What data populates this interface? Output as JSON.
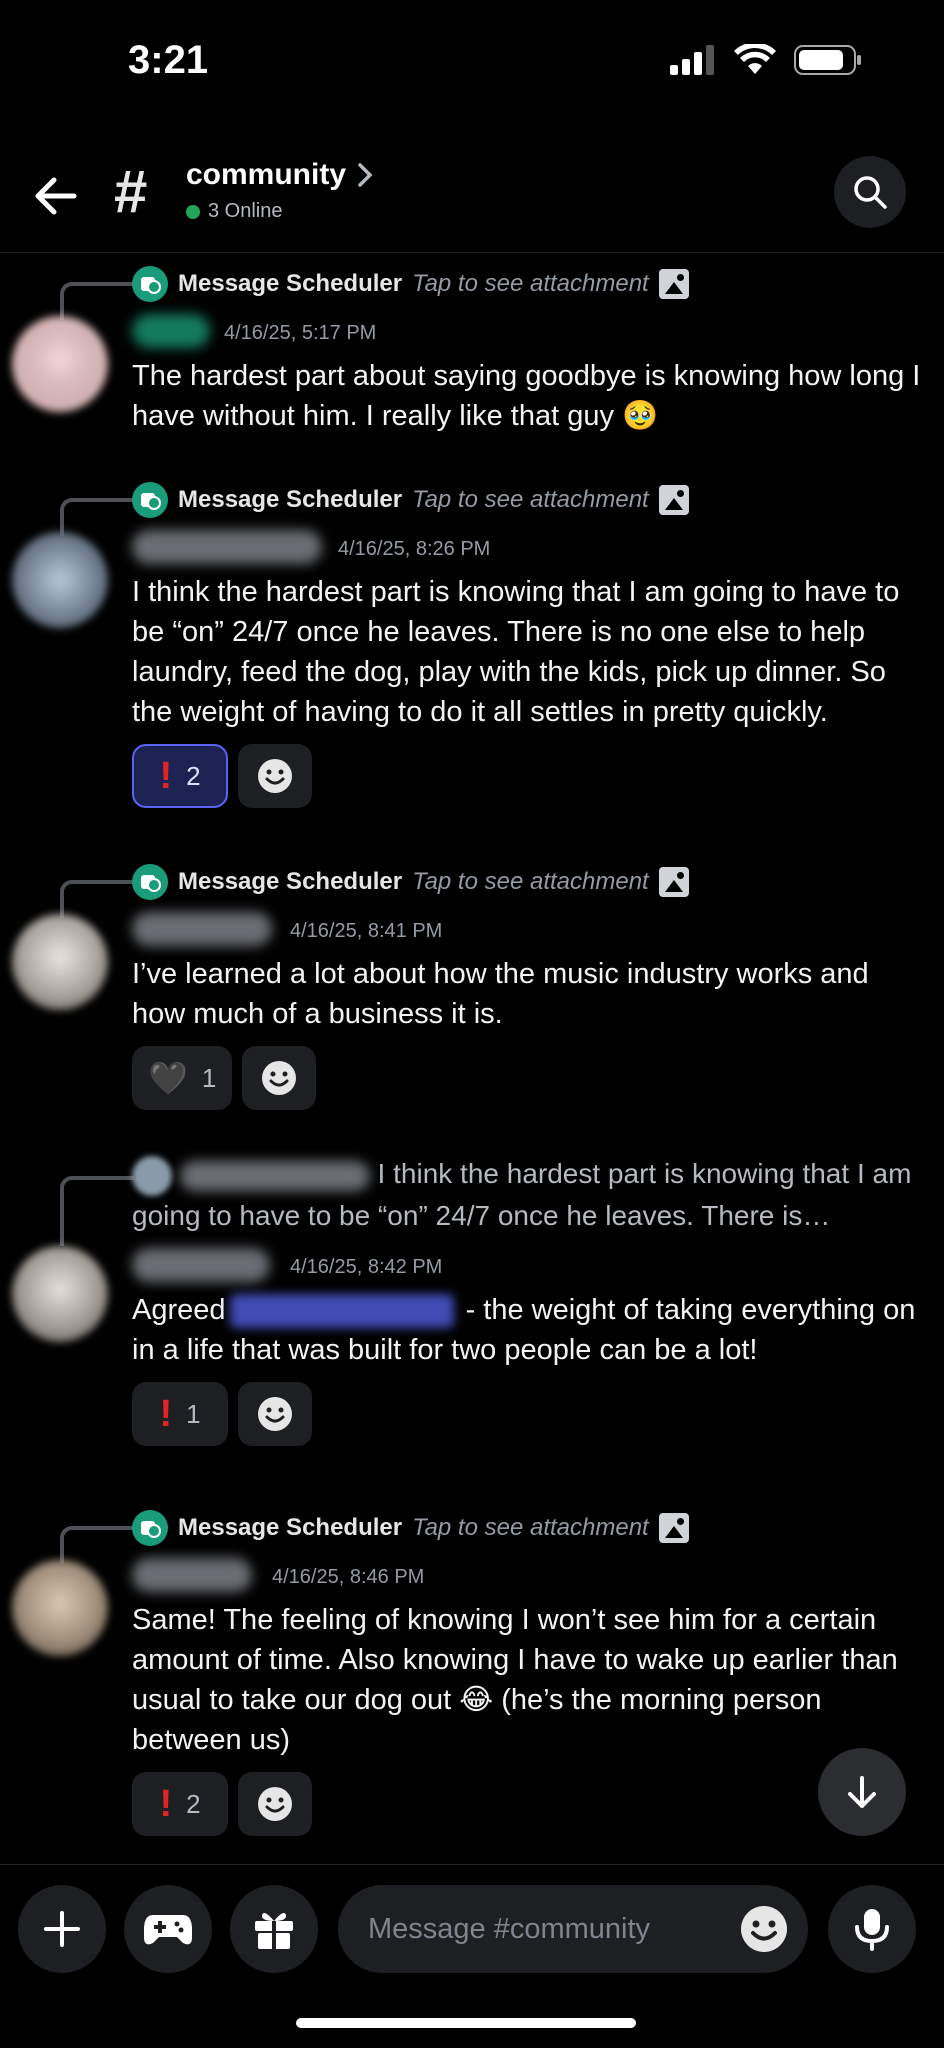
{
  "status_bar": {
    "time": "3:21"
  },
  "header": {
    "channel_name": "community",
    "online_text": "3 Online"
  },
  "messages": [
    {
      "reply_author": "Message Scheduler",
      "reply_hint": "Tap to see attachment",
      "timestamp": "4/16/25, 5:17 PM",
      "text": "The hardest part about saying goodbye is knowing how long I have without him. I really like that guy 🥹",
      "reactions": []
    },
    {
      "reply_author": "Message Scheduler",
      "reply_hint": "Tap to see attachment",
      "timestamp": "4/16/25, 8:26 PM",
      "text": "I think the hardest part is knowing that I am going to have to be “on” 24/7 once he leaves. There is no one else to help laundry, feed the dog, play with the kids, pick up dinner. So the weight of having to do it all settles in pretty quickly.",
      "reactions": [
        {
          "emoji": "!",
          "count": "2"
        }
      ]
    },
    {
      "reply_author": "Message Scheduler",
      "reply_hint": "Tap to see attachment",
      "timestamp": "4/16/25, 8:41 PM",
      "text": "I’ve learned a lot about how the music industry works and how much of a business it is.",
      "reactions": [
        {
          "emoji": "🖤",
          "count": "1"
        }
      ]
    },
    {
      "reply_preview": " I think the hardest part is knowing that I am going to have to be “on” 24/7 once he leaves. There is…",
      "timestamp": "4/16/25, 8:42 PM",
      "text_before": "Agreed",
      "text_after": " - the weight of taking everything on in a life that was built for two people can be a lot!",
      "reactions": [
        {
          "emoji": "!",
          "count": "1"
        }
      ]
    },
    {
      "reply_author": "Message Scheduler",
      "reply_hint": "Tap to see attachment",
      "timestamp": "4/16/25, 8:46 PM",
      "text": "Same! The feeling of knowing I won’t see him for a certain amount of time. Also knowing I have to wake up earlier than usual to take our dog out 😂 (he’s the morning person between us)",
      "reactions": [
        {
          "emoji": "!",
          "count": "2"
        }
      ]
    }
  ],
  "composer": {
    "placeholder": "Message #community"
  },
  "colors": {
    "accent": "#5865f2",
    "online": "#23a55a",
    "background": "#000000"
  }
}
